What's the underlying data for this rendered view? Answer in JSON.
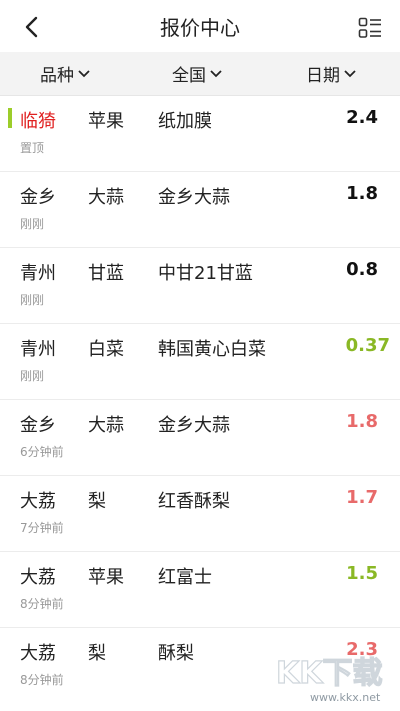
{
  "header": {
    "title": "报价中心"
  },
  "filters": [
    {
      "label": "品种"
    },
    {
      "label": "全国"
    },
    {
      "label": "日期"
    }
  ],
  "rows": [
    {
      "region": "临猗",
      "variety": "苹果",
      "name": "纸加膜",
      "price": "2.4",
      "time": "置顶",
      "pinned": true,
      "trend": "flat"
    },
    {
      "region": "金乡",
      "variety": "大蒜",
      "name": "金乡大蒜",
      "price": "1.8",
      "time": "刚刚",
      "pinned": false,
      "trend": "flat"
    },
    {
      "region": "青州",
      "variety": "甘蓝",
      "name": "中甘21甘蓝",
      "price": "0.8",
      "time": "刚刚",
      "pinned": false,
      "trend": "flat"
    },
    {
      "region": "青州",
      "variety": "白菜",
      "name": "韩国黄心白菜",
      "price": "0.37",
      "time": "刚刚",
      "pinned": false,
      "trend": "down"
    },
    {
      "region": "金乡",
      "variety": "大蒜",
      "name": "金乡大蒜",
      "price": "1.8",
      "time": "6分钟前",
      "pinned": false,
      "trend": "up"
    },
    {
      "region": "大荔",
      "variety": "梨",
      "name": "红香酥梨",
      "price": "1.7",
      "time": "7分钟前",
      "pinned": false,
      "trend": "up"
    },
    {
      "region": "大荔",
      "variety": "苹果",
      "name": "红富士",
      "price": "1.5",
      "time": "8分钟前",
      "pinned": false,
      "trend": "down"
    },
    {
      "region": "大荔",
      "variety": "梨",
      "name": "酥梨",
      "price": "2.3",
      "time": "8分钟前",
      "pinned": false,
      "trend": "up"
    }
  ],
  "colors": {
    "up": "#e86a6a",
    "down": "#8ab825",
    "flat": "#111111",
    "pin": "#e02020",
    "pin_bar": "#9ccd2a"
  },
  "watermark": {
    "logo": "KK下载",
    "url": "www.kkx.net"
  },
  "icons": {
    "back": "chevron-left-icon",
    "menu": "list-view-icon",
    "dropdown": "chevron-down-icon"
  }
}
